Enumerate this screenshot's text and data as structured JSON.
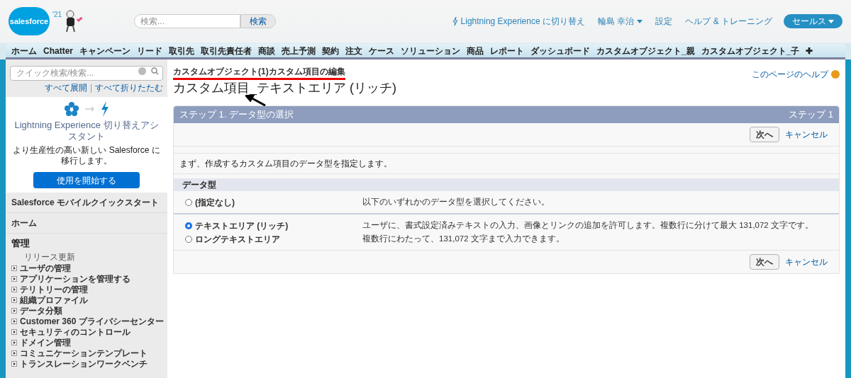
{
  "header": {
    "logo": "salesforce",
    "release": "'21",
    "search": {
      "placeholder": "検索...",
      "button": "検索"
    },
    "links": [
      {
        "kind": "lightning",
        "label": "Lightning Experience に切り替え"
      },
      {
        "kind": "user",
        "label": "輪島 幸治"
      },
      {
        "kind": "plain",
        "label": "設定"
      },
      {
        "kind": "plain",
        "label": "ヘルプ & トレーニング"
      }
    ],
    "app_menu": "セールス"
  },
  "tabs": [
    "ホーム",
    "Chatter",
    "キャンペーン",
    "リード",
    "取引先",
    "取引先責任者",
    "商談",
    "売上予測",
    "契約",
    "注文",
    "ケース",
    "ソリューション",
    "商品",
    "レポート",
    "ダッシュボード",
    "カスタムオブジェクト_親",
    "カスタムオブジェクト_子",
    "✚"
  ],
  "sidebar": {
    "search": {
      "placeholder": "クイック検索/検索..."
    },
    "expand_all": "すべて展開",
    "separator": "|",
    "collapse_all": "すべて折りたたむ",
    "assistant": {
      "title": "Lightning Experience 切り替えアシスタント",
      "description": "より生産性の高い新しい Salesforce に移行します。",
      "button": "使用を開始する"
    },
    "sections": [
      "Salesforce モバイルクイックスタート",
      "ホーム"
    ],
    "admin": {
      "title": "管理",
      "plain_item": "リリース更新",
      "items": [
        "ユーザの管理",
        "アプリケーションを管理する",
        "テリトリーの管理",
        "組織プロファイル",
        "データ分類",
        "Customer 360 プライバシーセンター",
        "セキュリティのコントロール",
        "ドメイン管理",
        "コミュニケーションテンプレート",
        "トランスレーションワークベンチ"
      ]
    }
  },
  "main": {
    "breadcrumb": "カスタムオブジェクト(1)カスタム項目の編集",
    "title": "カスタム項目_テキストエリア (リッチ)",
    "help": "このページのヘルプ",
    "step": {
      "title": "ステップ 1. データ型の選択",
      "counter": "ステップ 1",
      "top_actions": {
        "next": "次へ",
        "cancel": "キャンセル"
      },
      "intro": "まず、作成するカスタム項目のデータ型を指定します。",
      "section": "データ型",
      "groups": [
        [
          {
            "label": "(指定なし)",
            "selected": false,
            "description": "以下のいずれかのデータ型を選択してください。"
          }
        ],
        [
          {
            "label": "テキストエリア (リッチ)",
            "selected": true,
            "description": "ユーザに、書式設定済みテキストの入力、画像とリンクの追加を許可します。複数行に分けて最大 131,072 文字です。"
          },
          {
            "label": "ロングテキストエリア",
            "selected": false,
            "description": "複数行にわたって、131,072 文字まで入力できます。"
          }
        ]
      ],
      "bottom_actions": {
        "next": "次へ",
        "cancel": "キャンセル"
      }
    }
  }
}
